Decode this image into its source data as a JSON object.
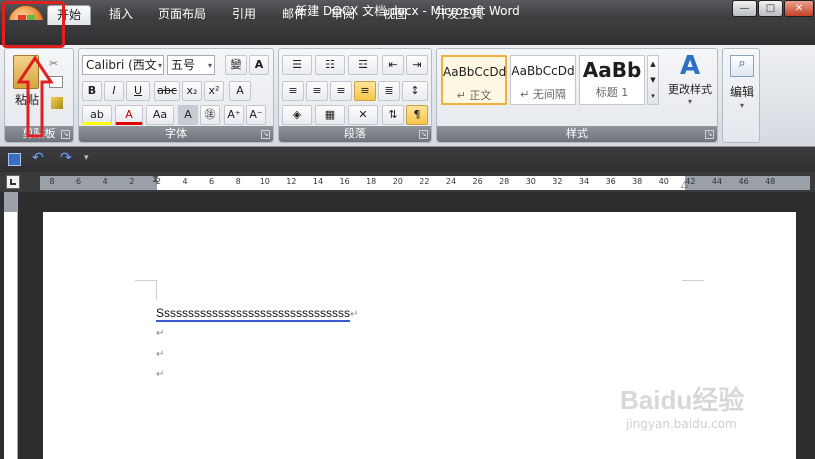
{
  "window": {
    "title": "新建 DOCX 文档.docx - Microsoft Word",
    "controls": [
      "—",
      "□",
      "✕"
    ]
  },
  "tabs": [
    "开始",
    "插入",
    "页面布局",
    "引用",
    "邮件",
    "审阅",
    "视图",
    "开发工具"
  ],
  "active_tab": "开始",
  "clipboard": {
    "paste_label": "粘贴",
    "group_label": "剪贴板"
  },
  "font": {
    "font_name": "Calibri (西文",
    "font_size": "五号",
    "group_label": "字体"
  },
  "paragraph": {
    "group_label": "段落"
  },
  "styles": {
    "items": [
      {
        "sample": "AaBbCcDd",
        "name": "↵ 正文"
      },
      {
        "sample": "AaBbCcDd",
        "name": "↵ 无间隔"
      },
      {
        "sample": "AaBb",
        "name": "标题 1"
      }
    ],
    "change_styles_label": "更改样式",
    "group_label": "样式"
  },
  "editing": {
    "label": "编辑"
  },
  "ruler": {
    "ticks": [
      "8",
      "6",
      "4",
      "2",
      "2",
      "4",
      "6",
      "8",
      "10",
      "12",
      "14",
      "16",
      "18",
      "20",
      "22",
      "24",
      "26",
      "28",
      "30",
      "32",
      "34",
      "36",
      "38",
      "40",
      "42",
      "44",
      "46",
      "48"
    ]
  },
  "document": {
    "lines": [
      "Ssssssssssssssssssssssssssssssss",
      "",
      "",
      ""
    ],
    "paragraph_mark": "↵"
  },
  "watermark": {
    "text": "Baidu经验",
    "url": "jingyan.baidu.com"
  },
  "colors": {
    "highlight": "#e02020",
    "ribbon_bg": "#e4e7ec",
    "titlebar_bg": "#3a3a3d"
  }
}
